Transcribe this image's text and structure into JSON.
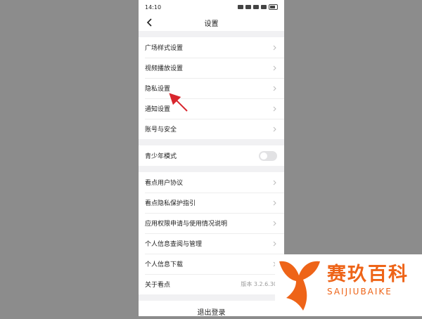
{
  "status_bar": {
    "time": "14:10"
  },
  "header": {
    "title": "设置"
  },
  "groups": {
    "g1": [
      {
        "label": "广场样式设置"
      },
      {
        "label": "视频播放设置"
      },
      {
        "label": "隐私设置"
      },
      {
        "label": "通知设置"
      },
      {
        "label": "账号与安全"
      }
    ],
    "teen": {
      "label": "青少年模式",
      "enabled": false
    },
    "g3": [
      {
        "label": "看点用户协议"
      },
      {
        "label": "看点隐私保护指引"
      },
      {
        "label": "应用权限申请与使用情况说明"
      },
      {
        "label": "个人信息查阅与管理"
      },
      {
        "label": "个人信息下载"
      }
    ],
    "about": {
      "label": "关于看点",
      "version": "版本 3.2.6.30"
    }
  },
  "logout": {
    "label": "退出登录"
  },
  "watermark": {
    "title": "赛玖百科",
    "subtitle": "SAIJIUBAIKE"
  },
  "colors": {
    "arrow": "#d8262d",
    "watermark": "#ee6418",
    "background": "#8c8c8c"
  }
}
